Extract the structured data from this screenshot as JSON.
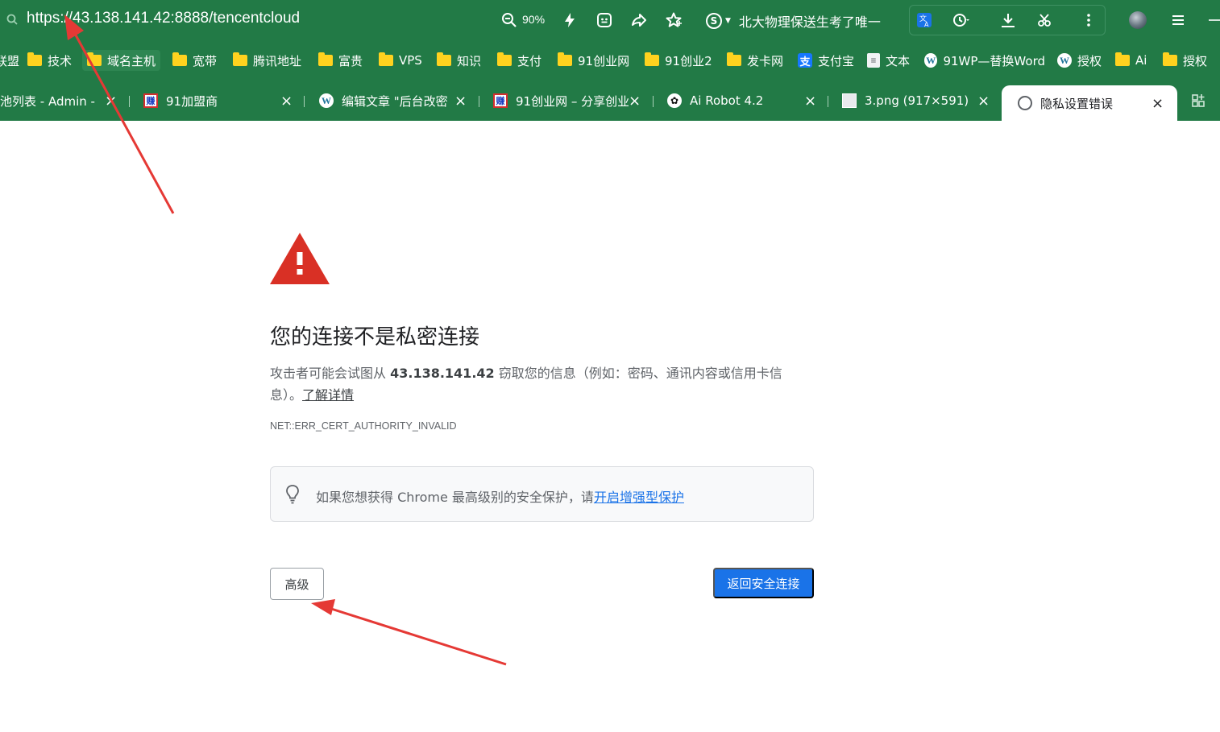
{
  "browser": {
    "url": "https://43.138.141.42:8888/tencentcloud",
    "zoom": "90%",
    "news_ticker": "北大物理保送生考了唯一"
  },
  "bookmarks": [
    {
      "label": "联盟",
      "icon": "folder-icon"
    },
    {
      "label": "技术",
      "icon": "folder-icon"
    },
    {
      "label": "域名主机",
      "icon": "folder-icon"
    },
    {
      "label": "宽带",
      "icon": "folder-icon"
    },
    {
      "label": "腾讯地址",
      "icon": "folder-icon"
    },
    {
      "label": "富贵",
      "icon": "folder-icon"
    },
    {
      "label": "VPS",
      "icon": "folder-icon"
    },
    {
      "label": "知识",
      "icon": "folder-icon"
    },
    {
      "label": "支付",
      "icon": "folder-icon"
    },
    {
      "label": "91创业网",
      "icon": "folder-icon"
    },
    {
      "label": "91创业2",
      "icon": "folder-icon"
    },
    {
      "label": "发卡网",
      "icon": "folder-icon"
    },
    {
      "label": "支付宝",
      "icon": "alipay-icon"
    },
    {
      "label": "文本",
      "icon": "document-icon"
    },
    {
      "label": "91WP—替换Word",
      "icon": "wordpress-icon"
    },
    {
      "label": "授权",
      "icon": "wordpress-icon"
    },
    {
      "label": "Ai",
      "icon": "folder-icon"
    },
    {
      "label": "授权",
      "icon": "folder-icon"
    }
  ],
  "tabs": [
    {
      "title": "池列表 - Admin -",
      "icon": "none"
    },
    {
      "title": "91加盟商",
      "icon": "zhuan-icon"
    },
    {
      "title": "编辑文章 \"后台改密",
      "icon": "wordpress-icon"
    },
    {
      "title": "91创业网 – 分享创业",
      "icon": "zhuan-icon"
    },
    {
      "title": "Ai Robot 4.2",
      "icon": "openai-icon"
    },
    {
      "title": "3.png (917×591)",
      "icon": "image-icon"
    },
    {
      "title": "隐私设置错误",
      "icon": "globe-icon"
    }
  ],
  "page": {
    "heading": "您的连接不是私密连接",
    "desc_prefix": "攻击者可能会试图从 ",
    "desc_host": "43.138.141.42",
    "desc_suffix": " 窃取您的信息（例如：密码、通讯内容或信用卡信息）。",
    "learn_more": "了解详情",
    "error_code": "NET::ERR_CERT_AUTHORITY_INVALID",
    "enhanced_text": "如果您想获得 Chrome 最高级别的安全保护，请",
    "enhanced_link": "开启增强型保护",
    "advanced_button": "高级",
    "back_button": "返回安全连接"
  },
  "colors": {
    "chrome_bg": "#227a46",
    "warning_red": "#d93025",
    "primary_blue": "#1a73e8",
    "annotation_red": "#e53935"
  }
}
